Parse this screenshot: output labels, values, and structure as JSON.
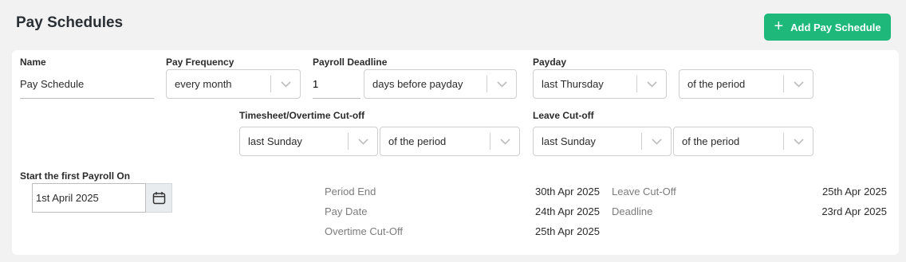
{
  "header": {
    "title": "Pay Schedules",
    "add_button_label": "Add Pay Schedule",
    "add_icon": "plus-icon",
    "accent_color": "#1db87a"
  },
  "form": {
    "name": {
      "label": "Name",
      "value": "Pay Schedule"
    },
    "pay_frequency": {
      "label": "Pay Frequency",
      "value": "every month"
    },
    "payroll_deadline": {
      "label": "Payroll Deadline",
      "days_value": "1",
      "unit_value": "days before payday"
    },
    "payday": {
      "label": "Payday",
      "day_value": "last Thursday",
      "period_value": "of the period"
    },
    "timesheet_cutoff": {
      "label": "Timesheet/Overtime Cut-off",
      "day_value": "last Sunday",
      "period_value": "of the period"
    },
    "leave_cutoff": {
      "label": "Leave Cut-off",
      "day_value": "last Sunday",
      "period_value": "of the period"
    },
    "start_payroll": {
      "label": "Start the first Payroll On",
      "value": "1st April 2025",
      "icon": "calendar-icon"
    }
  },
  "summary": {
    "left": [
      {
        "label": "Period End",
        "value": "30th Apr 2025"
      },
      {
        "label": "Pay Date",
        "value": "24th Apr 2025"
      },
      {
        "label": "Overtime Cut-Off",
        "value": "25th Apr 2025"
      }
    ],
    "right": [
      {
        "label": "Leave Cut-Off",
        "value": "25th Apr 2025"
      },
      {
        "label": "Deadline",
        "value": "23rd Apr 2025"
      }
    ]
  }
}
